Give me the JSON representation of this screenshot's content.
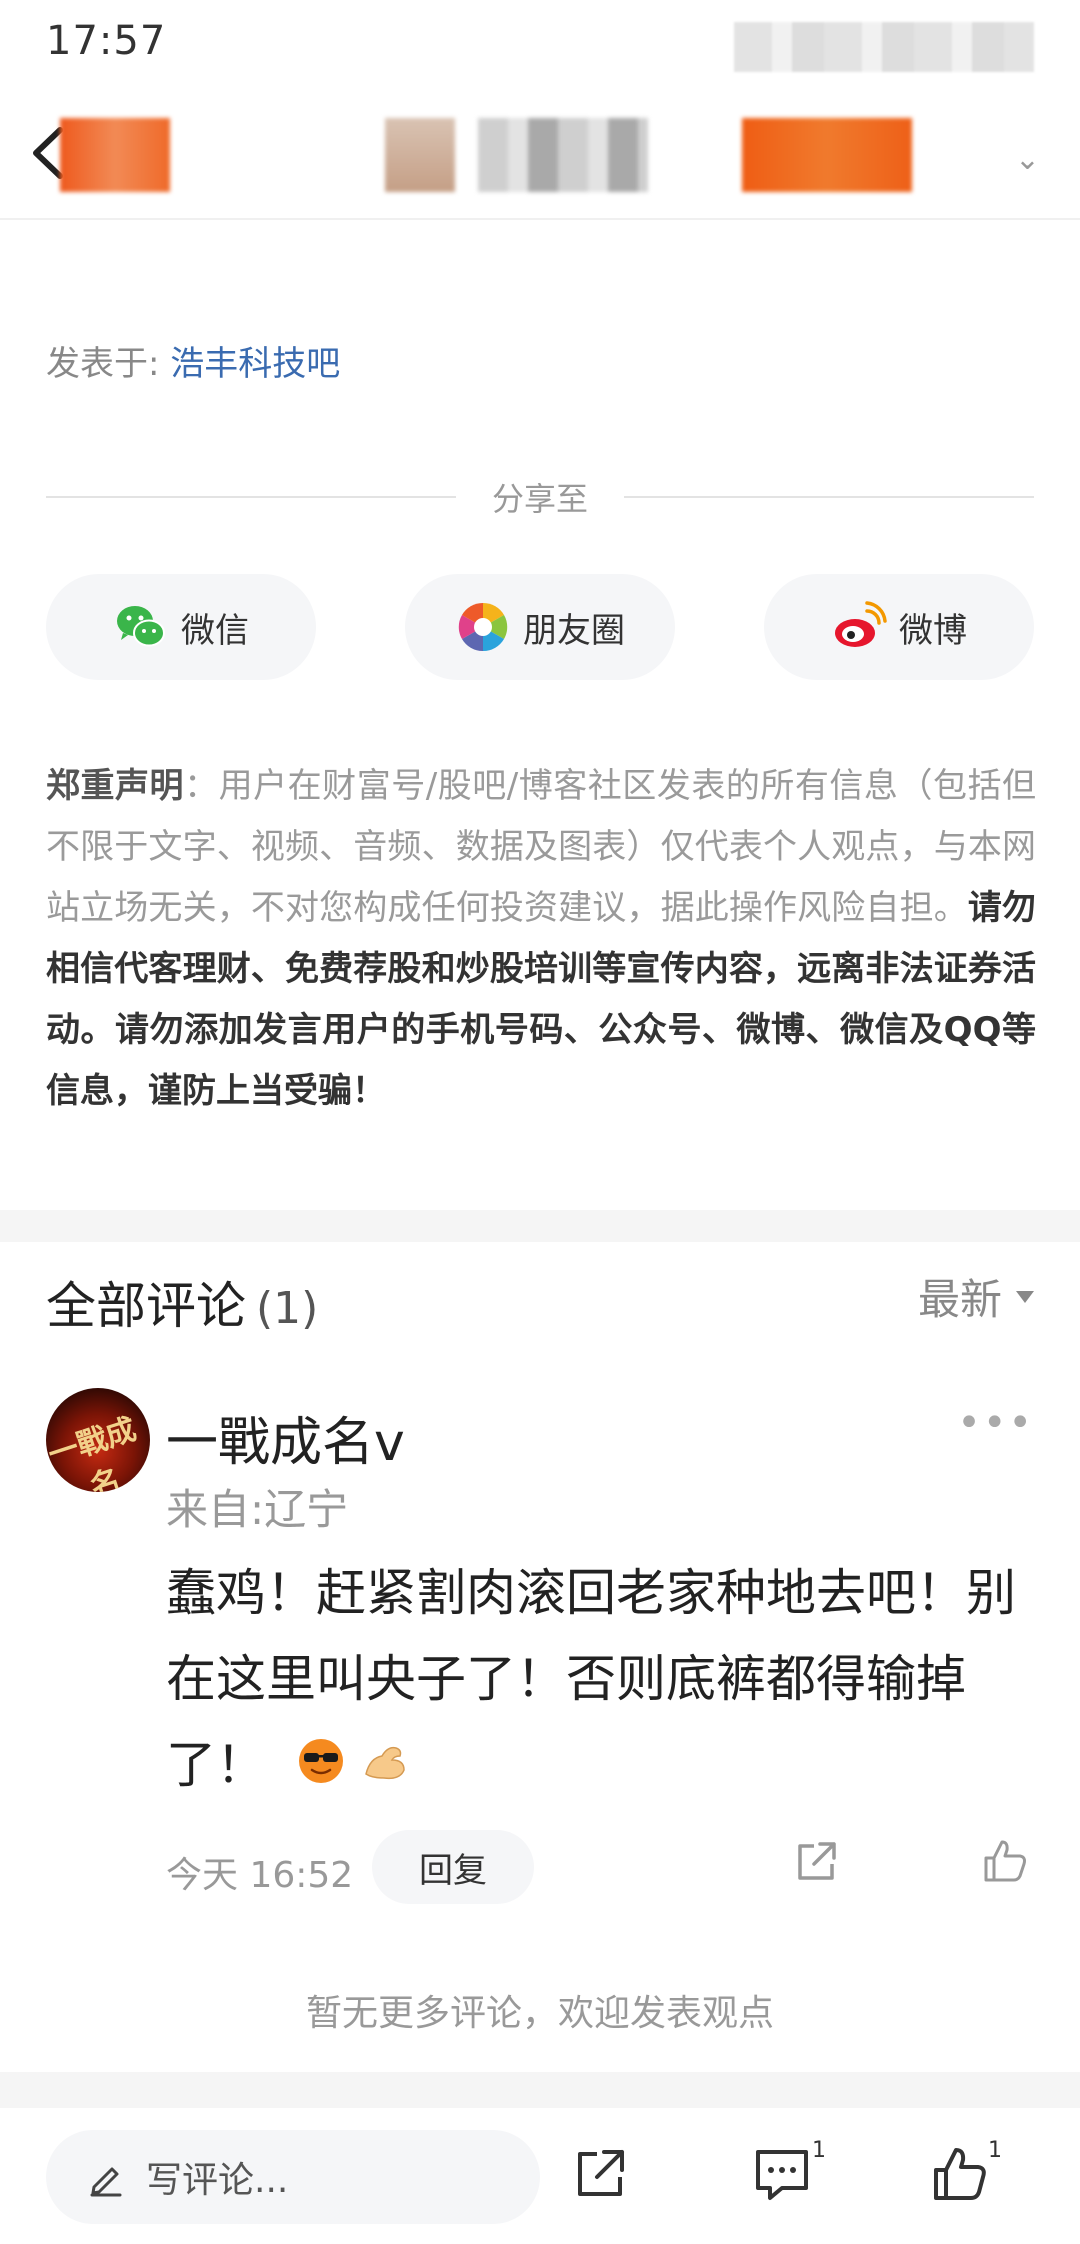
{
  "status_bar": {
    "time": "17:57"
  },
  "post": {
    "posted_in_label": "发表于:",
    "forum": "浩丰科技吧"
  },
  "share": {
    "title": "分享至",
    "buttons": [
      {
        "label": "微信",
        "icon": "wechat-icon"
      },
      {
        "label": "朋友圈",
        "icon": "moments-icon"
      },
      {
        "label": "微博",
        "icon": "weibo-icon"
      }
    ]
  },
  "disclaimer": {
    "title": "郑重声明",
    "text": "：用户在财富号/股吧/博客社区发表的所有信息（包括但不限于文字、视频、音频、数据及图表）仅代表个人观点，与本网站立场无关，不对您构成任何投资建议，据此操作风险自担。",
    "warning": "请勿相信代客理财、免费荐股和炒股培训等宣传内容，远离非法证券活动。请勿添加发言用户的手机号码、公众号、微博、微信及QQ等信息，谨防上当受骗！"
  },
  "comments": {
    "title": "全部评论",
    "count": "(1)",
    "sort": "最新",
    "items": [
      {
        "avatar_text": "一戰成名",
        "user": "一戰成名v",
        "from": "来自:辽宁",
        "body": "蠢鸡！赶紧割肉滚回老家种地去吧！别在这里叫央子了！否则底裤都得输掉了！",
        "emojis": [
          "sunglasses-emoji-icon",
          "muscle-emoji-icon"
        ],
        "time": "今天 16:52",
        "reply_label": "回复"
      }
    ],
    "no_more": "暂无更多评论，欢迎发表观点"
  },
  "bottom_bar": {
    "write_placeholder": "写评论...",
    "comment_count": "1",
    "like_count": "1"
  },
  "colors": {
    "link": "#3a6bb0",
    "accent_orange": "#ef5d14"
  }
}
